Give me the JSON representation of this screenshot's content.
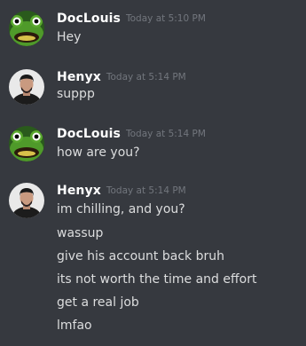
{
  "messages": [
    {
      "username": "DocLouis",
      "timestamp": "Today at 5:10 PM",
      "avatar": "frog-avatar-icon",
      "lines": [
        "Hey"
      ]
    },
    {
      "username": "Henyx",
      "timestamp": "Today at 5:14 PM",
      "avatar": "person-avatar-icon",
      "lines": [
        "suppp"
      ]
    },
    {
      "username": "DocLouis",
      "timestamp": "Today at 5:14 PM",
      "avatar": "frog-avatar-icon",
      "lines": [
        "how are you?"
      ]
    },
    {
      "username": "Henyx",
      "timestamp": "Today at 5:14 PM",
      "avatar": "person-avatar-icon",
      "lines": [
        "im chilling, and you?",
        "wassup",
        "give his account back bruh",
        "its not worth the time and effort",
        "get a real job",
        "lmfao"
      ]
    }
  ],
  "colors": {
    "background": "#36393f",
    "username": "#ffffff",
    "timestamp": "#72767d",
    "message_text": "#dcddde"
  }
}
